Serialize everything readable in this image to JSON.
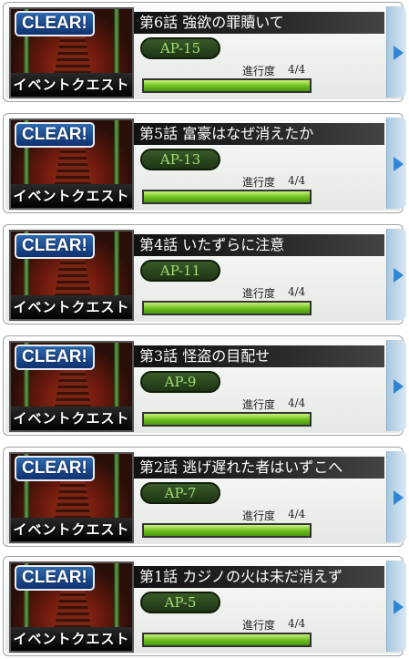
{
  "quests": [
    {
      "badge": "CLEAR!",
      "event_label": "イベントクエスト",
      "title": "第6話 強欲の罪贖いて",
      "ap": "AP-15",
      "progress_label": "進行度",
      "progress_text": "4/4",
      "progress_fraction": 1.0
    },
    {
      "badge": "CLEAR!",
      "event_label": "イベントクエスト",
      "title": "第5話 富豪はなぜ消えたか",
      "ap": "AP-13",
      "progress_label": "進行度",
      "progress_text": "4/4",
      "progress_fraction": 1.0
    },
    {
      "badge": "CLEAR!",
      "event_label": "イベントクエスト",
      "title": "第4話 いたずらに注意",
      "ap": "AP-11",
      "progress_label": "進行度",
      "progress_text": "4/4",
      "progress_fraction": 1.0
    },
    {
      "badge": "CLEAR!",
      "event_label": "イベントクエスト",
      "title": "第3話 怪盗の目配せ",
      "ap": "AP-9",
      "progress_label": "進行度",
      "progress_text": "4/4",
      "progress_fraction": 1.0
    },
    {
      "badge": "CLEAR!",
      "event_label": "イベントクエスト",
      "title": "第2話 逃げ遅れた者はいずこへ",
      "ap": "AP-7",
      "progress_label": "進行度",
      "progress_text": "4/4",
      "progress_fraction": 1.0
    },
    {
      "badge": "CLEAR!",
      "event_label": "イベントクエスト",
      "title": "第1話 カジノの火は未だ消えず",
      "ap": "AP-5",
      "progress_label": "進行度",
      "progress_text": "4/4",
      "progress_fraction": 1.0
    }
  ],
  "colors": {
    "progress_fill": "#6bbd1e",
    "ap_text": "#9fe070",
    "clear_badge": "#1f4f94",
    "arrow": "#2f86d6"
  },
  "icons": {
    "next_arrow": "chevron-right-icon"
  }
}
